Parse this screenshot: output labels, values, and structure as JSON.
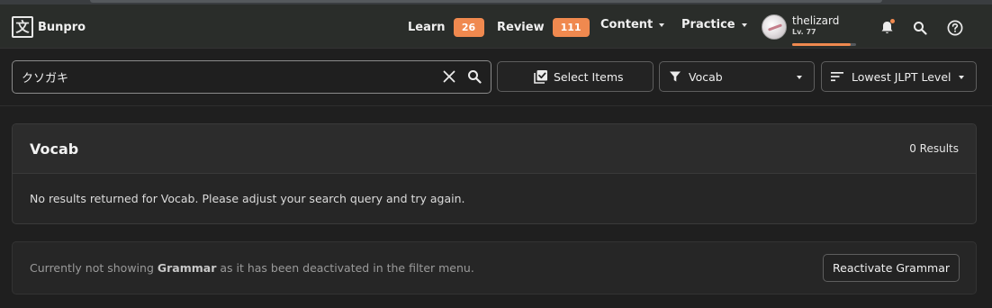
{
  "app": {
    "name": "Bunpro",
    "logo_glyph": "文"
  },
  "nav": {
    "learn": {
      "label": "Learn",
      "count": "26"
    },
    "review": {
      "label": "Review",
      "count": "111"
    },
    "content": {
      "label": "Content"
    },
    "practice": {
      "label": "Practice"
    }
  },
  "user": {
    "name": "thelizard",
    "level": "Lv. 77",
    "xp_progress_fraction": 0.92
  },
  "icons": {
    "notifications": "bell-icon",
    "search": "search-icon",
    "help": "help-circle-icon"
  },
  "colors": {
    "accent": "#f0894f",
    "background": "#1f1f1f",
    "navbar": "#2a2d2a"
  },
  "search": {
    "value": "クソガキ"
  },
  "controls": {
    "select_items": "Select Items",
    "type_filter": "Vocab",
    "sort": "Lowest JLPT Level"
  },
  "results_card": {
    "title": "Vocab",
    "count": "0 Results",
    "empty_message": "No results returned for Vocab. Please adjust your search query and try again."
  },
  "notice": {
    "prefix": "Currently not showing",
    "category": "Grammar",
    "suffix": "as it has been deactivated in the filter menu.",
    "button": "Reactivate Grammar"
  }
}
